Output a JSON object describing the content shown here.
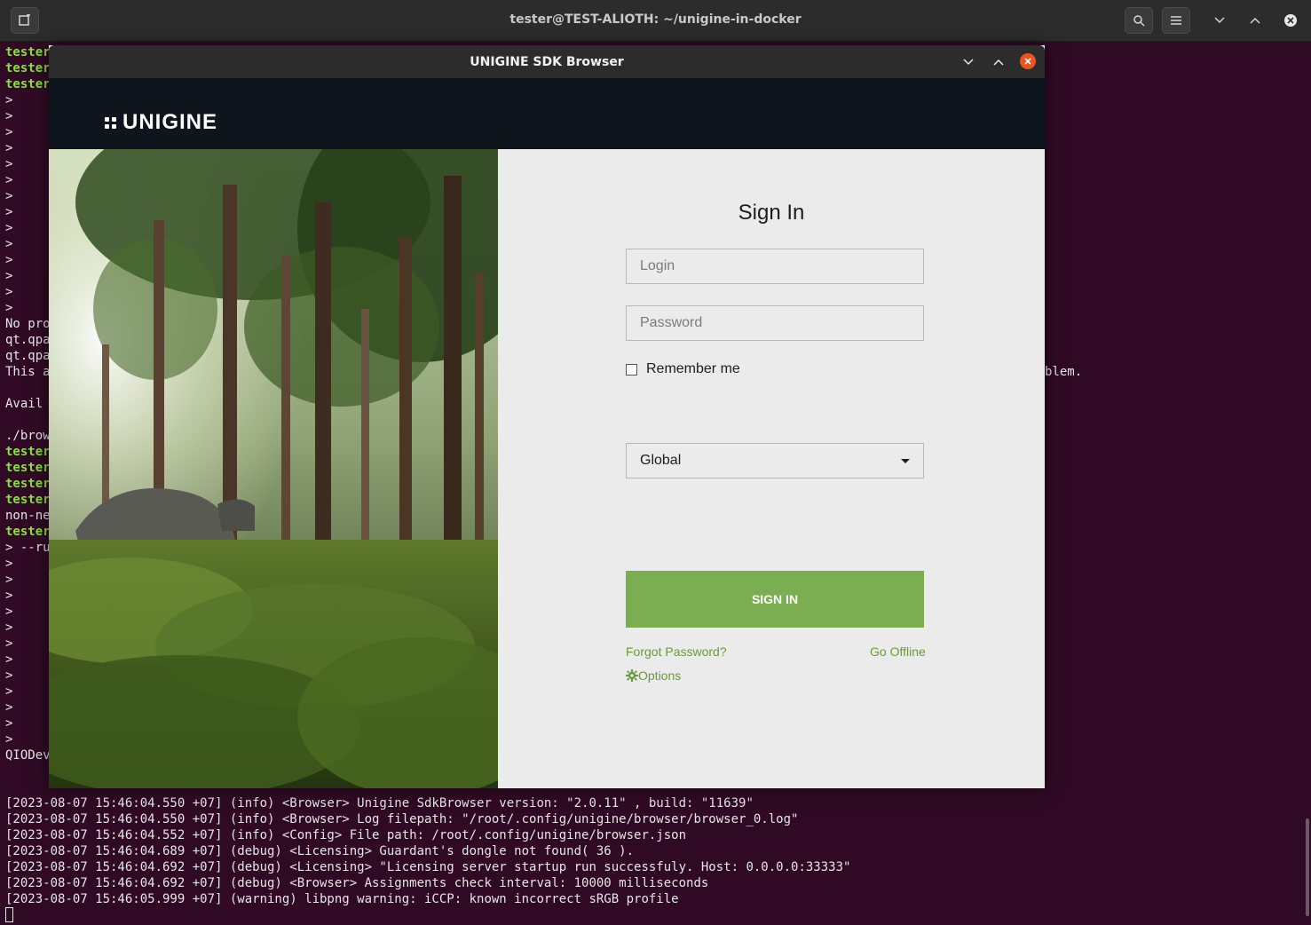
{
  "terminal": {
    "title": "tester@TEST-ALIOTH: ~/unigine-in-docker",
    "lines_top": [
      {
        "text": "tester",
        "style": "green"
      },
      {
        "text": "tester",
        "style": "green"
      },
      {
        "text": "tester",
        "style": "green"
      },
      {
        "text": ">"
      },
      {
        "text": ">"
      },
      {
        "text": ">"
      },
      {
        "text": ">"
      },
      {
        "text": ">"
      },
      {
        "text": ">"
      },
      {
        "text": ">"
      },
      {
        "text": ">"
      },
      {
        "text": ">"
      },
      {
        "text": ">"
      },
      {
        "text": ">"
      },
      {
        "text": ">"
      },
      {
        "text": ">"
      },
      {
        "text": ">"
      },
      {
        "text": "No pro"
      },
      {
        "text": "qt.qpa"
      },
      {
        "text": "qt.qpa"
      },
      {
        "text": "This a",
        "tail": "blem."
      },
      {
        "text": ""
      },
      {
        "text": "Avail"
      },
      {
        "text": ""
      },
      {
        "text": "./brow"
      },
      {
        "text": "tester",
        "style": "green"
      },
      {
        "text": "tester",
        "style": "green"
      },
      {
        "text": "tester",
        "style": "green"
      },
      {
        "text": "tester",
        "style": "green"
      },
      {
        "text": "non-ne"
      },
      {
        "text": "tester",
        "style": "green"
      },
      {
        "text": "> --ru"
      },
      {
        "text": ">"
      },
      {
        "text": ">"
      },
      {
        "text": ">"
      },
      {
        "text": ">"
      },
      {
        "text": ">"
      },
      {
        "text": ">"
      },
      {
        "text": ">"
      },
      {
        "text": ">"
      },
      {
        "text": ">"
      },
      {
        "text": ">"
      },
      {
        "text": ">"
      },
      {
        "text": ">"
      },
      {
        "text": "QIODev"
      }
    ],
    "lines_bottom": [
      "[2023-08-07 15:46:04.550 +07] (info) <Browser> Unigine SdkBrowser version: \"2.0.11\" , build: \"11639\"",
      "[2023-08-07 15:46:04.550 +07] (info) <Browser> Log filepath: \"/root/.config/unigine/browser/browser_0.log\"",
      "[2023-08-07 15:46:04.552 +07] (info) <Config> File path: /root/.config/unigine/browser.json",
      "[2023-08-07 15:46:04.689 +07] (debug) <Licensing> Guardant's dongle not found( 36 ).",
      "[2023-08-07 15:46:04.692 +07] (debug) <Licensing> \"Licensing server startup run successfuly. Host: 0.0.0.0:33333\"",
      "[2023-08-07 15:46:04.692 +07] (debug) <Browser> Assignments check interval: 10000 milliseconds",
      "[2023-08-07 15:46:05.999 +07] (warning) libpng warning: iCCP: known incorrect sRGB profile"
    ]
  },
  "app": {
    "title": "UNIGINE SDK Browser",
    "logo_text": "UNIGINE",
    "signin": {
      "heading": "Sign In",
      "login_placeholder": "Login",
      "password_placeholder": "Password",
      "remember_label": "Remember me",
      "server_selected": "Global",
      "button_label": "SIGN IN",
      "forgot_label": "Forgot Password?",
      "offline_label": "Go Offline",
      "options_label": "Options"
    }
  },
  "colors": {
    "terminal_bg": "#300a24",
    "prompt_green": "#8ae234",
    "accent_green": "#7aae50",
    "link_green": "#6b9a3c",
    "close_orange": "#e95420"
  }
}
